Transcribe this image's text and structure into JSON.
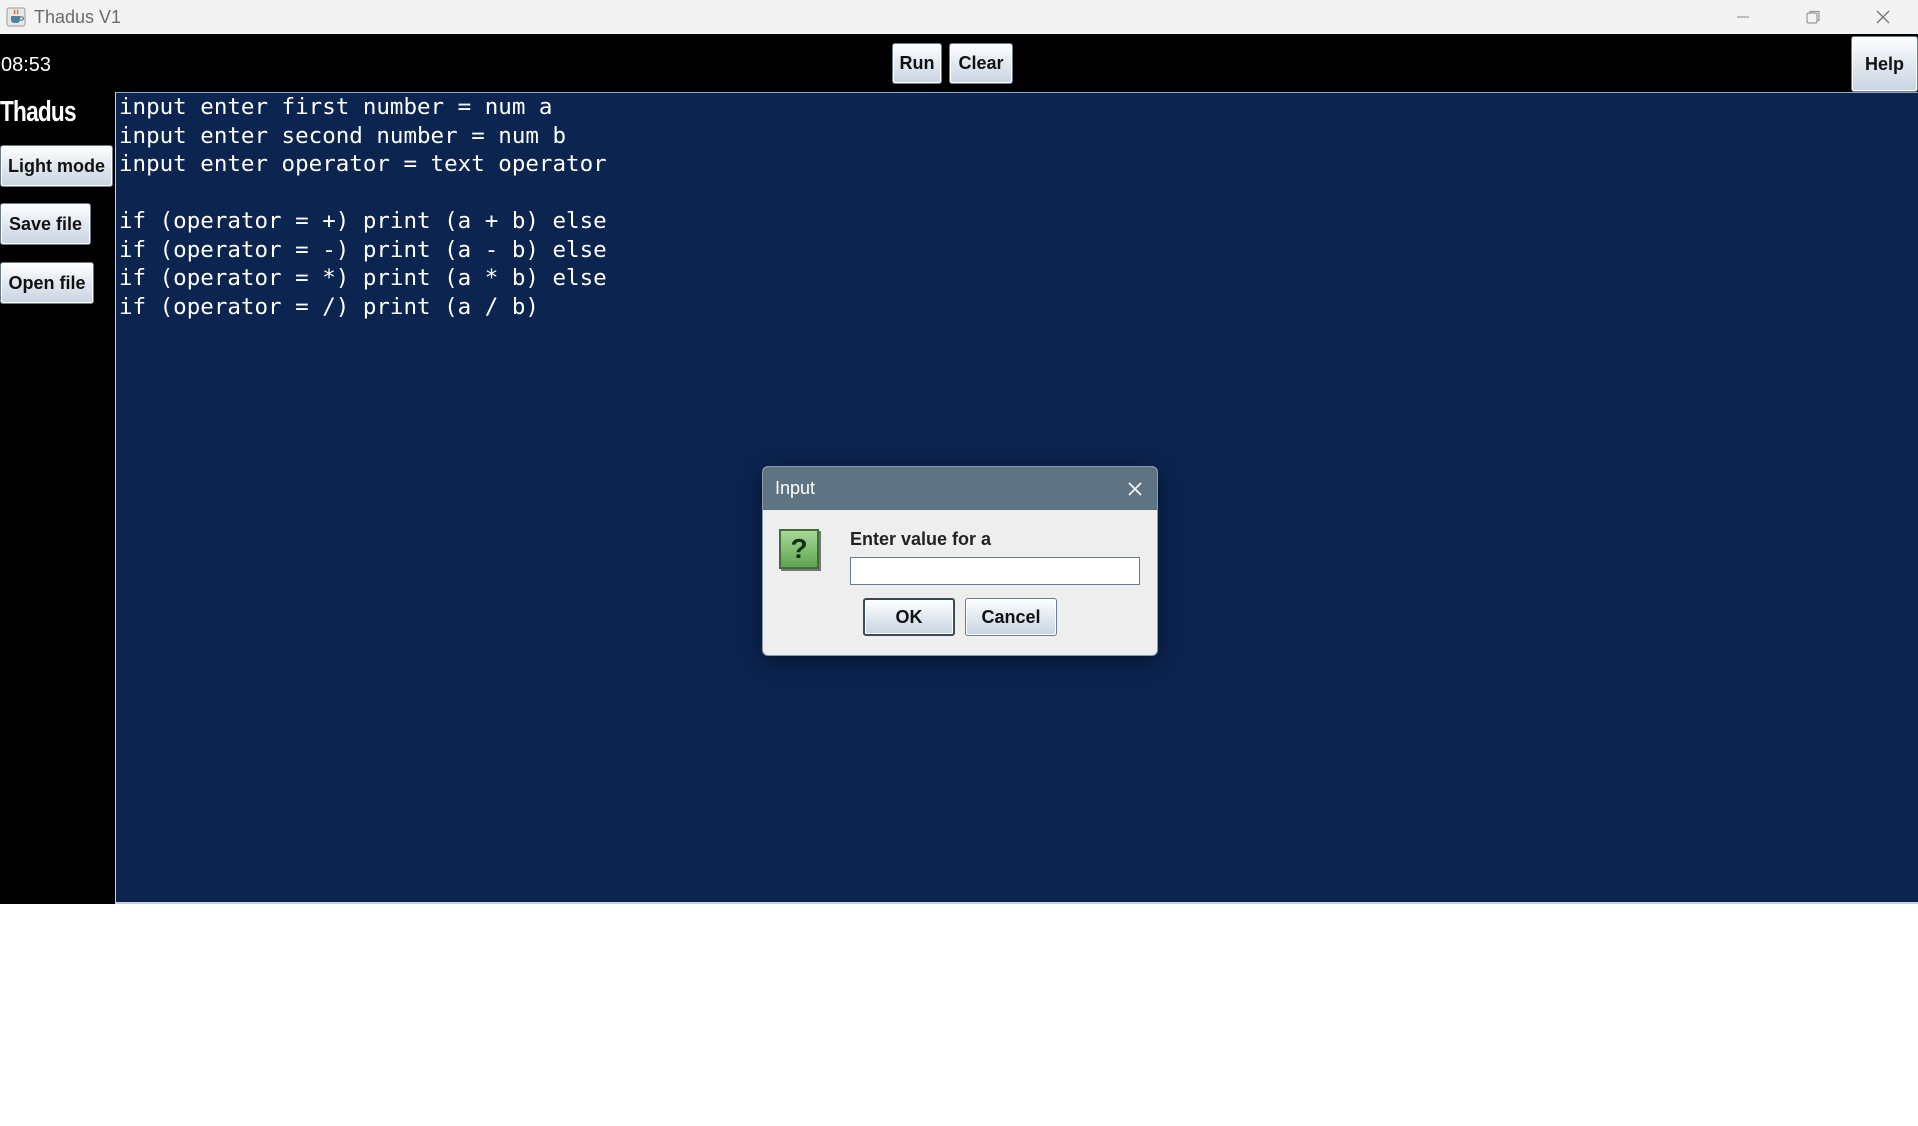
{
  "window": {
    "title": "Thadus V1",
    "icon": "java-coffee-icon",
    "controls": [
      "minimize-icon",
      "restore-icon",
      "close-icon"
    ]
  },
  "toolbar": {
    "clock": "08:53",
    "run_label": "Run",
    "clear_label": "Clear",
    "help_label": "Help"
  },
  "sidebar": {
    "brand": "Thadus",
    "light_mode_label": "Light mode",
    "save_file_label": "Save file",
    "open_file_label": "Open file"
  },
  "editor": {
    "background": "#0b2450",
    "lines": [
      "input enter first number = num a",
      "input enter second number = num b",
      "input enter operator = text operator",
      "",
      "if (operator = +) print (a + b) else",
      "if (operator = -) print (a - b) else",
      "if (operator = *) print (a * b) else",
      "if (operator = /) print (a / b)"
    ]
  },
  "dialog": {
    "title": "Input",
    "icon": "question-icon",
    "icon_glyph": "?",
    "message": "Enter value for a",
    "input_value": "",
    "ok_label": "OK",
    "cancel_label": "Cancel"
  }
}
